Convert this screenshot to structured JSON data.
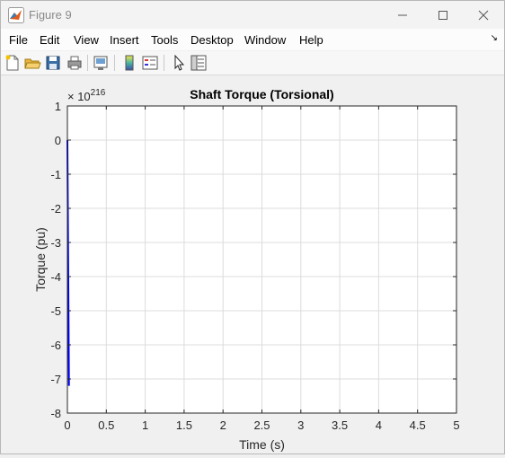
{
  "window": {
    "title": "Figure 9"
  },
  "menu": {
    "items": [
      "File",
      "Edit",
      "View",
      "Insert",
      "Tools",
      "Desktop",
      "Window",
      "Help"
    ]
  },
  "toolbar": {
    "icons": [
      "new-figure-icon",
      "open-file-icon",
      "save-icon",
      "print-icon",
      "print-preview-icon",
      "colorbar-icon",
      "legend-icon",
      "pointer-icon",
      "property-editor-icon"
    ]
  },
  "chart_data": {
    "type": "line",
    "title": "Shaft Torque (Torsional)",
    "xlabel": "Time (s)",
    "ylabel": "Torque (pu)",
    "exponent_base": "× 10",
    "exponent_power": "216",
    "xlim": [
      0,
      5
    ],
    "ylim": [
      -8,
      1
    ],
    "xticks": [
      0,
      0.5,
      1,
      1.5,
      2,
      2.5,
      3,
      3.5,
      4,
      4.5,
      5
    ],
    "yticks": [
      1,
      0,
      -1,
      -2,
      -3,
      -4,
      -5,
      -6,
      -7,
      -8
    ],
    "grid": true,
    "series": [
      {
        "color": "#0000ff",
        "x": [
          0,
          0.005,
          0.01,
          0.015,
          0.02
        ],
        "y": [
          0,
          -1.8,
          -3.6,
          -5.4,
          -7.2
        ]
      }
    ]
  }
}
